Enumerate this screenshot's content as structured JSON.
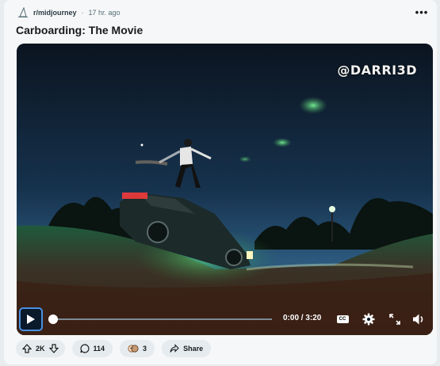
{
  "post": {
    "subreddit": "r/midjourney",
    "separator": "·",
    "time_ago": "17 hr. ago",
    "more_label": "•••",
    "title": "Carboarding: The Movie"
  },
  "video": {
    "watermark": "@DARRI3D",
    "time_display": "0:00 / 3:20",
    "cc_label": "CC",
    "progress_fraction": 0
  },
  "actions": {
    "votes": "2K",
    "comments": "114",
    "awards": "3",
    "share": "Share"
  },
  "icons": {
    "subreddit": "midjourney-sail-icon",
    "more": "more-options-icon",
    "play": "play-icon",
    "settings": "gear-icon",
    "fullscreen": "expand-icon",
    "volume": "volume-icon",
    "upvote": "upvote-arrow-icon",
    "downvote": "downvote-arrow-icon",
    "comment": "comment-bubble-icon",
    "award": "award-icon",
    "share": "share-arrow-icon"
  }
}
